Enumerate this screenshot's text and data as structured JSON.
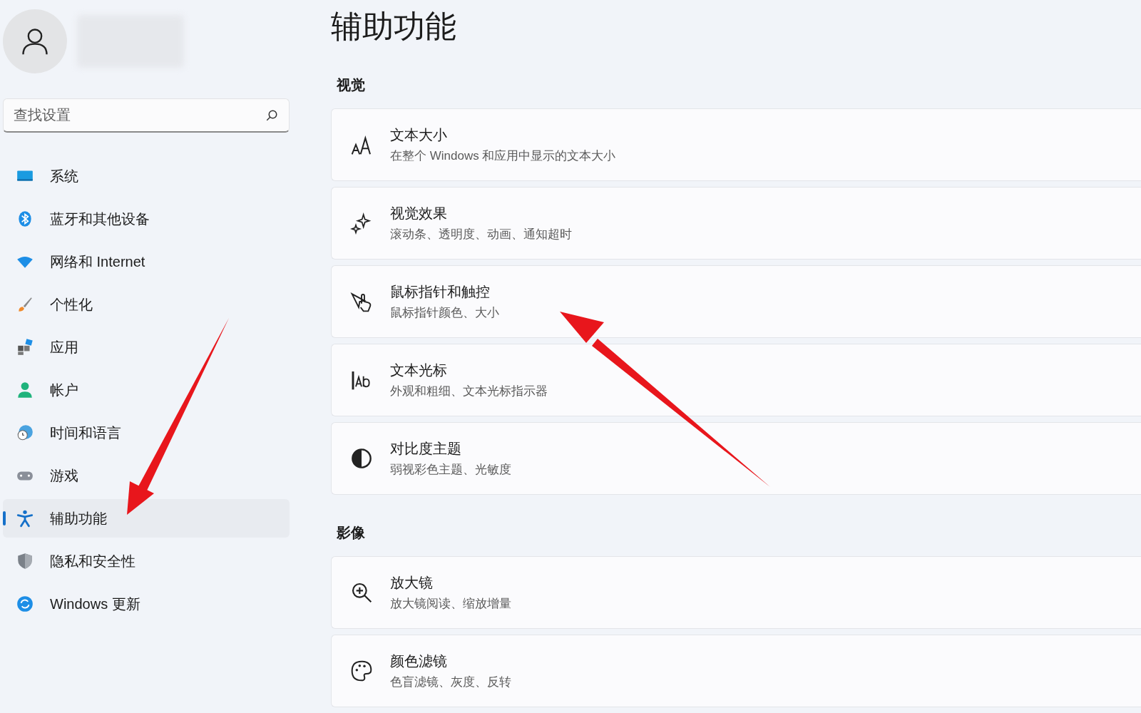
{
  "search": {
    "placeholder": "查找设置"
  },
  "nav": [
    {
      "label": "系统",
      "selected": false
    },
    {
      "label": "蓝牙和其他设备",
      "selected": false
    },
    {
      "label": "网络和 Internet",
      "selected": false
    },
    {
      "label": "个性化",
      "selected": false
    },
    {
      "label": "应用",
      "selected": false
    },
    {
      "label": "帐户",
      "selected": false
    },
    {
      "label": "时间和语言",
      "selected": false
    },
    {
      "label": "游戏",
      "selected": false
    },
    {
      "label": "辅助功能",
      "selected": true
    },
    {
      "label": "隐私和安全性",
      "selected": false
    },
    {
      "label": "Windows 更新",
      "selected": false
    }
  ],
  "page_title": "辅助功能",
  "sections": [
    {
      "heading": "视觉",
      "items": [
        {
          "title": "文本大小",
          "subtitle": "在整个 Windows 和应用中显示的文本大小"
        },
        {
          "title": "视觉效果",
          "subtitle": "滚动条、透明度、动画、通知超时"
        },
        {
          "title": "鼠标指针和触控",
          "subtitle": "鼠标指针颜色、大小"
        },
        {
          "title": "文本光标",
          "subtitle": "外观和粗细、文本光标指示器"
        },
        {
          "title": "对比度主题",
          "subtitle": "弱视彩色主题、光敏度"
        }
      ]
    },
    {
      "heading": "影像",
      "items": [
        {
          "title": "放大镜",
          "subtitle": "放大镜阅读、缩放增量"
        },
        {
          "title": "颜色滤镜",
          "subtitle": "色盲滤镜、灰度、反转"
        }
      ]
    }
  ]
}
